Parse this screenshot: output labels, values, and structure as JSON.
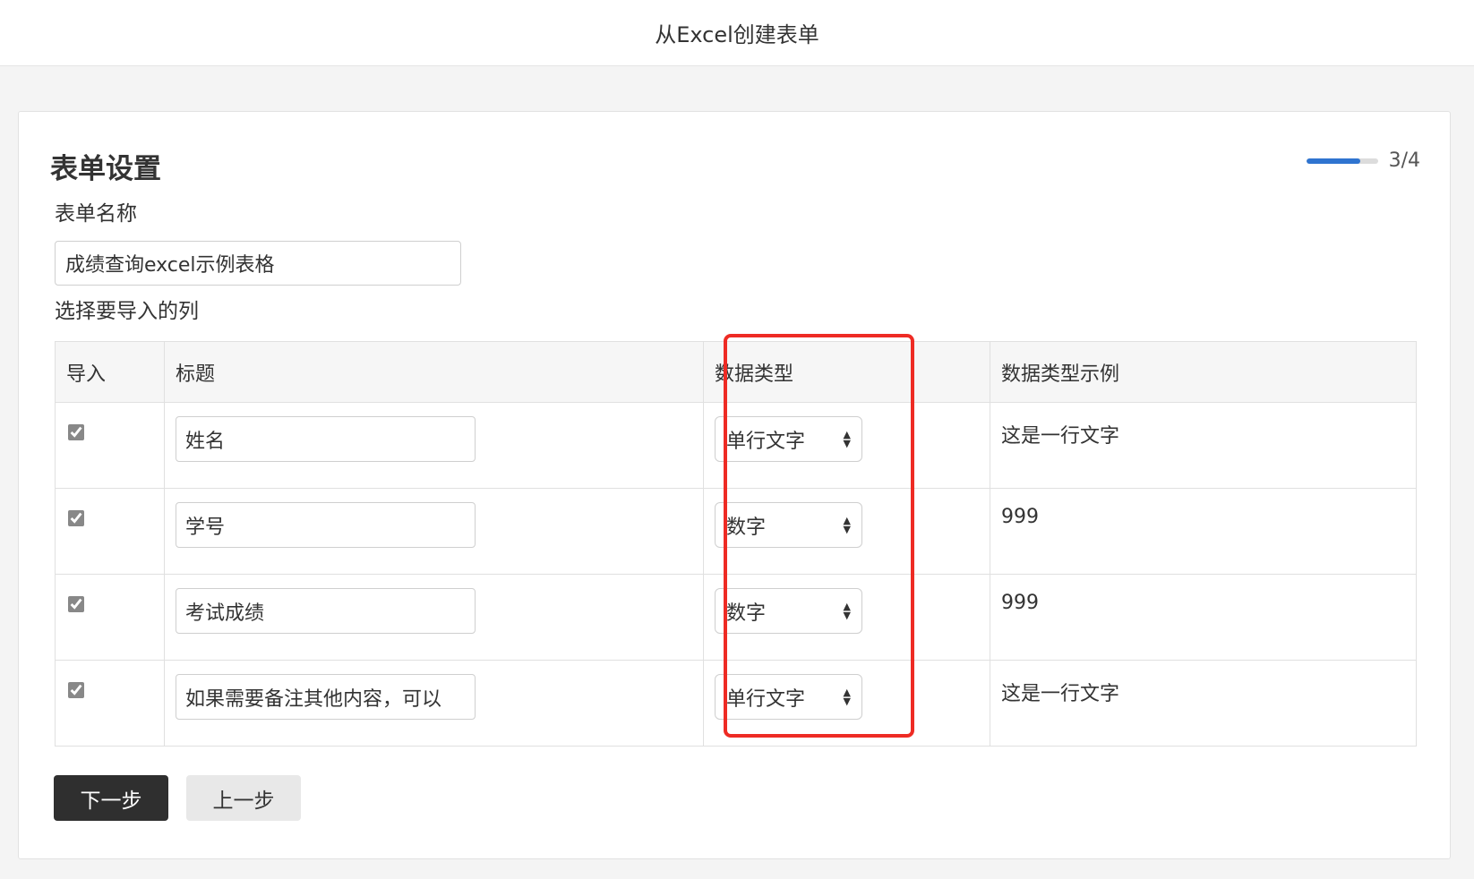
{
  "header": {
    "title": "从Excel创建表单"
  },
  "card": {
    "title": "表单设置",
    "progress": {
      "text": "3/4",
      "fraction": 0.75,
      "color": "#2f74d0"
    }
  },
  "form": {
    "name_label": "表单名称",
    "name_value": "成绩查询excel示例表格",
    "columns_label": "选择要导入的列"
  },
  "table": {
    "headers": [
      "导入",
      "标题",
      "数据类型",
      "数据类型示例"
    ],
    "rows": [
      {
        "import": true,
        "title": "姓名",
        "type": "单行文字",
        "example": "这是一行文字"
      },
      {
        "import": true,
        "title": "学号",
        "type": "数字",
        "example": "999"
      },
      {
        "import": true,
        "title": "考试成绩",
        "type": "数字",
        "example": "999"
      },
      {
        "import": true,
        "title": "如果需要备注其他内容，可以",
        "type": "单行文字",
        "example": "这是一行文字"
      }
    ]
  },
  "buttons": {
    "next": "下一步",
    "prev": "上一步"
  },
  "annotation": {
    "highlight_color": "#ee2b24"
  }
}
